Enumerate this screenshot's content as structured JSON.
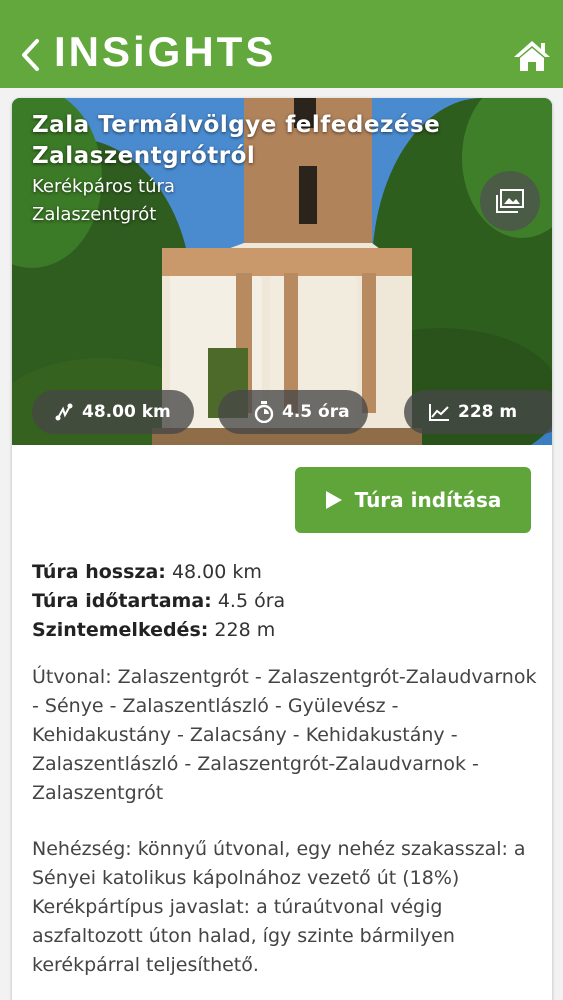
{
  "app": {
    "title": "INSiGHTS"
  },
  "tour": {
    "title": "Zala Termálvölgye felfedezése Zalaszentgrótról",
    "type": "Kerékpáros túra",
    "city": "Zalaszentgrót",
    "stats": {
      "distance": "48.00 km",
      "duration": "4.5 óra",
      "elevation": "228 m"
    },
    "start_label": "Túra indítása",
    "facts": [
      {
        "label": "Túra hossza:",
        "value": "48.00 km"
      },
      {
        "label": "Túra időtartama:",
        "value": "4.5 óra"
      },
      {
        "label": "Szintemelkedés:",
        "value": "228 m"
      }
    ],
    "route": "Útvonal: Zalaszentgrót - Zalaszentgrót-Zalaudvarnok - Sénye - Zalaszentlászló - Gyülevész - Kehidakustány - Zalacsány - Kehidakustány - Zalaszentlászló - Zalaszentgrót-Zalaudvarnok - Zalaszentgrót",
    "difficulty": "Nehézség: könnyű útvonal, egy nehéz szakasszal: a Sényei katolikus kápolnához vezető út (18%)",
    "bike": "Kerékpártípus javaslat: a túraútvonal végig aszfaltozott úton halad, így szinte bármilyen kerékpárral teljesíthető."
  },
  "icons": {
    "back": "chevron-left-icon",
    "home": "home-icon",
    "gallery": "image-gallery-icon",
    "distance": "route-icon",
    "duration": "stopwatch-icon",
    "elevation": "elevation-chart-icon",
    "play": "play-icon"
  },
  "colors": {
    "brand_green": "#62a83d",
    "button_green": "#5fa53a"
  }
}
